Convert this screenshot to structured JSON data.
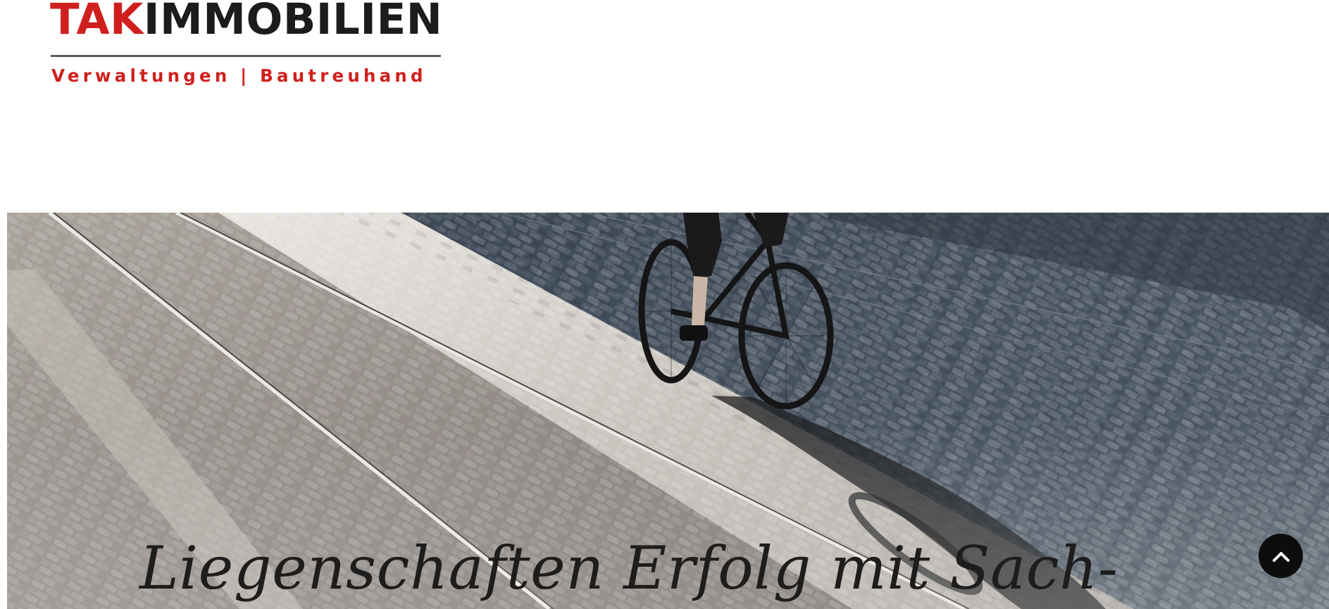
{
  "header": {
    "logo": {
      "brand_red": "TAK",
      "brand_black": "IMMOBILIEN",
      "tagline": "Verwaltungen | Bautreuhand"
    }
  },
  "hero": {
    "image": "cyclist-on-cobblestone-tram-street",
    "heading": "Liegenschaften Erfolg mit Sach-"
  },
  "back_to_top": {
    "icon": "chevron-up-icon"
  },
  "colors": {
    "brand_red": "#d0201e",
    "brand_black": "#1c1c1c",
    "button_bg": "#0d0d0d",
    "heading_text": "#1d1d1d"
  }
}
